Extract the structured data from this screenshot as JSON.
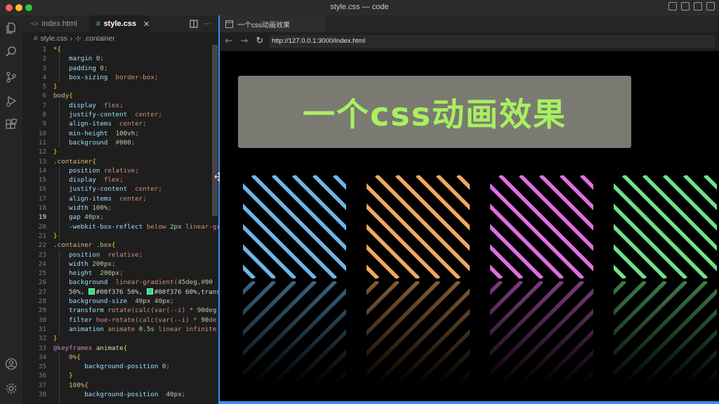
{
  "window": {
    "title": "style.css — code"
  },
  "editor": {
    "tabs": [
      {
        "label": "index.html"
      },
      {
        "label": "style.css"
      }
    ],
    "breadcrumb": {
      "file": "style.css",
      "separator": "›",
      "symbol": ".container"
    },
    "lines": [
      [
        "1",
        "*{"
      ],
      [
        "2",
        "    margin:0;"
      ],
      [
        "3",
        "    padding:0;"
      ],
      [
        "4",
        "    box-sizing: border-box;"
      ],
      [
        "5",
        "}"
      ],
      [
        "6",
        "body{"
      ],
      [
        "7",
        "    display: flex;"
      ],
      [
        "8",
        "    justify-content: center;"
      ],
      [
        "9",
        "    align-items: center;"
      ],
      [
        "10",
        "    min-height: 100vh;"
      ],
      [
        "11",
        "    background: #000;"
      ],
      [
        "12",
        "}"
      ],
      [
        "13",
        ".container{"
      ],
      [
        "14",
        "    position:relative;"
      ],
      [
        "15",
        "    display: flex;"
      ],
      [
        "16",
        "    justify-content: center;"
      ],
      [
        "17",
        "    align-items: center;"
      ],
      [
        "18",
        "    width:100%;"
      ],
      [
        "19",
        "    gap:40px;"
      ],
      [
        "20",
        "    -webkit-box-reflect:below 2px linear-gr"
      ],
      [
        "21",
        "}"
      ],
      [
        "22",
        ".container .box{"
      ],
      [
        "23",
        "    position: relative;"
      ],
      [
        "24",
        "    width:200px;"
      ],
      [
        "25",
        "    height: 200px;"
      ],
      [
        "26",
        "    background: linear-gradient(45deg,#00"
      ],
      [
        "27",
        "    50%, #00f376 50%, #00f376 60%,transp"
      ],
      [
        "28",
        "    background-size: 40px 40px;"
      ],
      [
        "29",
        "    transform:rotate(calc(var(--i) * 90deg"
      ],
      [
        "30",
        "    filter:hue-rotate(calc(var(--i) * 90de"
      ],
      [
        "31",
        "    animation:animate 0.5s linear infinite"
      ],
      [
        "32",
        "}"
      ],
      [
        "33",
        "@keyframes animate{"
      ],
      [
        "34",
        "    0%{"
      ],
      [
        "35",
        "        background-position:0;"
      ],
      [
        "36",
        "    }"
      ],
      [
        "37",
        "    100%{"
      ],
      [
        "38",
        "        background-position: 40px;"
      ]
    ]
  },
  "browser": {
    "tab_title": "一个css动画效果",
    "url": "http://127.0.0.1:3000/index.html",
    "banner": "一个css动画效果",
    "boxes": [
      {
        "color": "#6fb6e6",
        "i": 0
      },
      {
        "color": "#f0a860",
        "i": 1
      },
      {
        "color": "#e070e0",
        "i": 2
      },
      {
        "color": "#6ee28a",
        "i": 3
      }
    ]
  },
  "colors": {
    "accent": "#3b8eea",
    "banner_text": "#a8f060",
    "banner_bg": "#7a7a72",
    "swatch_green": "#00f376"
  }
}
